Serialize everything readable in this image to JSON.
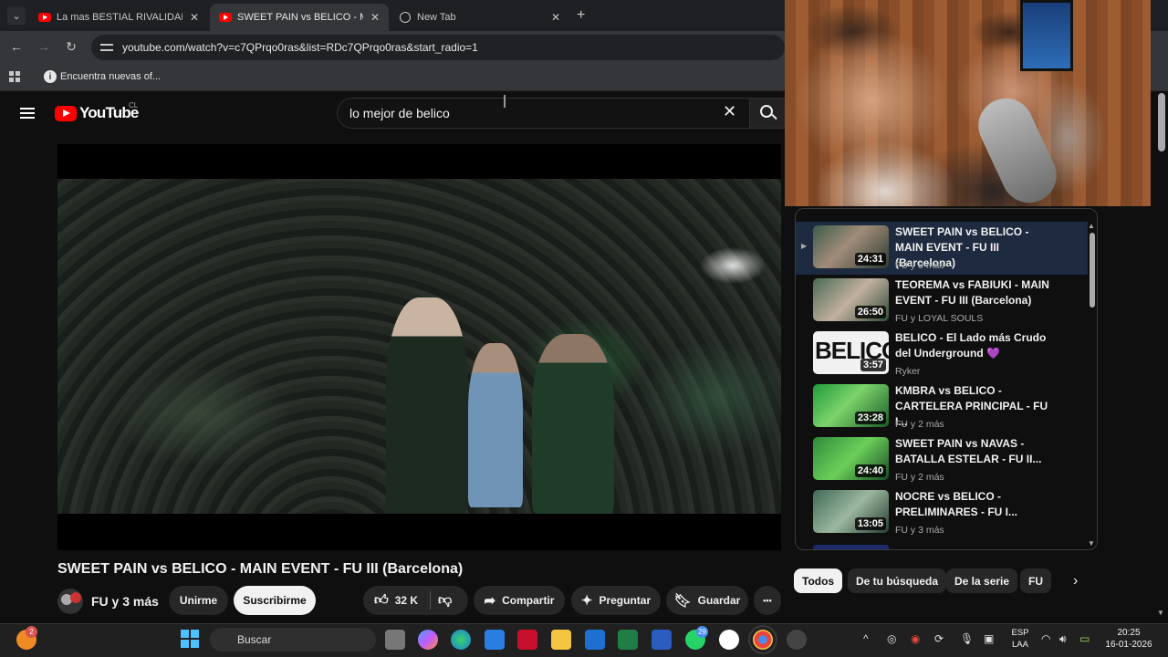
{
  "browser": {
    "tabs": [
      {
        "title": "La mas BESTIAL RIVALIDAD de",
        "active": false,
        "favicon": "youtube-icon"
      },
      {
        "title": "SWEET PAIN vs BELICO - MAIN",
        "active": true,
        "favicon": "youtube-icon"
      },
      {
        "title": "New Tab",
        "active": false,
        "favicon": "globe-icon"
      }
    ],
    "tab_close_glyph": "✕",
    "new_tab_glyph": "+",
    "url": "youtube.com/watch?v=c7QPrqo0ras&list=RDc7QPrqo0ras&start_radio=1",
    "bookmark_label": "Encuentra nuevas of..."
  },
  "youtube": {
    "logo_text": "YouTube",
    "country_code": "CL",
    "search_value": "lo mejor de belico"
  },
  "video": {
    "title": "SWEET PAIN vs BELICO - MAIN EVENT - FU III (Barcelona)",
    "channel": "FU y 3 más",
    "join_label": "Unirme",
    "subscribe_label": "Suscribirme",
    "likes": "32 K",
    "share_label": "Compartir",
    "ask_label": "Preguntar",
    "save_label": "Guardar",
    "more_glyph": "•••"
  },
  "playlist": [
    {
      "title": "SWEET PAIN vs BELICO - MAIN EVENT - FU III (Barcelona)",
      "channel": "FU y 3 más",
      "duration": "24:31",
      "active": true
    },
    {
      "title": "TEOREMA vs FABIUKI - MAIN EVENT - FU III (Barcelona)",
      "channel": "FU y LOYAL SOULS",
      "duration": "26:50",
      "active": false
    },
    {
      "title": "BELICO - El Lado más Crudo del Underground 💜",
      "channel": "Ryker",
      "duration": "3:57",
      "active": false,
      "thumb_text": "BELICO"
    },
    {
      "title": "KMBRA vs BELICO - CARTELERA PRINCIPAL - FU I...",
      "channel": "FU y 2 más",
      "duration": "23:28",
      "active": false
    },
    {
      "title": "SWEET PAIN vs NAVAS - BATALLA ESTELAR - FU II...",
      "channel": "FU y 2 más",
      "duration": "24:40",
      "active": false
    },
    {
      "title": "NOCRE vs BELICO - PRELIMINARES - FU I...",
      "channel": "FU y 3 más",
      "duration": "13:05",
      "active": false
    }
  ],
  "chips": [
    {
      "label": "Todos",
      "active": true
    },
    {
      "label": "De tu búsqueda",
      "active": false
    },
    {
      "label": "De la serie",
      "active": false
    },
    {
      "label": "FU",
      "active": false
    }
  ],
  "taskbar": {
    "search_placeholder": "Buscar",
    "notification_count": "2",
    "whatsapp_badge": "29",
    "language_line1": "ESP",
    "language_line2": "LAA",
    "time": "20:25",
    "date": "16-01-2026"
  }
}
